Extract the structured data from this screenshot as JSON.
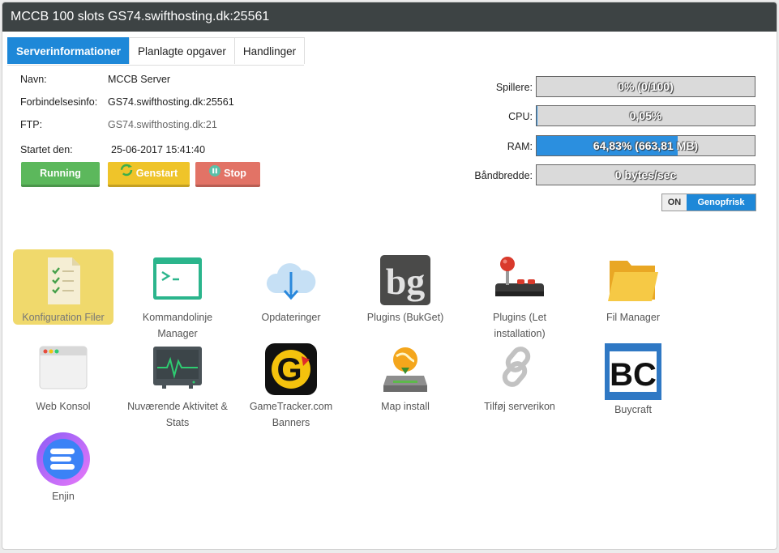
{
  "header": {
    "title": "MCCB 100 slots GS74.swifthosting.dk:25561"
  },
  "tabs": [
    {
      "label": "Serverinformationer",
      "active": true
    },
    {
      "label": "Planlagte opgaver",
      "active": false
    },
    {
      "label": "Handlinger",
      "active": false
    }
  ],
  "info": {
    "name_label": "Navn:",
    "name_value": "MCCB Server",
    "conn_label": "Forbindelsesinfo:",
    "conn_value": "GS74.swifthosting.dk:25561",
    "ftp_label": "FTP:",
    "ftp_value": "GS74.swifthosting.dk:21",
    "started_label": "Startet den:",
    "started_value": "25-06-2017 15:41:40"
  },
  "controls": {
    "running": "Running",
    "restart": "Genstart",
    "stop": "Stop"
  },
  "stats": {
    "players": {
      "label": "Spillere:",
      "text": "0% (0/100)",
      "percent": 0
    },
    "cpu": {
      "label": "CPU:",
      "text": "0,05%",
      "percent": 0.05
    },
    "ram": {
      "label": "RAM:",
      "text": "64,83% (663,81 MB)",
      "percent": 64.83
    },
    "bandwidth": {
      "label": "Båndbredde:",
      "text": "0 bytes/sec",
      "percent": 0
    }
  },
  "refresh": {
    "state": "ON",
    "label": "Genopfrisk"
  },
  "colors": {
    "accent": "#1e88d8",
    "titlebar": "#3d4344",
    "running": "#5cb85c",
    "restart": "#efc42a",
    "stop": "#e27366",
    "highlight": "#f0d96c"
  },
  "tiles": [
    {
      "label": "Konfiguration Filer",
      "icon": "config-file-icon"
    },
    {
      "label": "Kommandolinje Manager",
      "icon": "terminal-icon"
    },
    {
      "label": "Opdateringer",
      "icon": "cloud-download-icon"
    },
    {
      "label": "Plugins (BukGet)",
      "icon": "bukget-icon",
      "logo_text": "bg"
    },
    {
      "label": "Plugins (Let installation)",
      "icon": "joystick-icon"
    },
    {
      "label": "Fil Manager",
      "icon": "folder-icon"
    },
    {
      "label": "Web Konsol",
      "icon": "browser-window-icon"
    },
    {
      "label": "Nuværende Aktivitet & Stats",
      "icon": "activity-monitor-icon"
    },
    {
      "label": "GameTracker.com Banners",
      "icon": "gametracker-icon",
      "logo_text": "G"
    },
    {
      "label": "Map install",
      "icon": "map-install-icon"
    },
    {
      "label": "Tilføj serverikon",
      "icon": "link-icon"
    },
    {
      "label": "Buycraft",
      "icon": "buycraft-icon",
      "logo_text": "BC"
    },
    {
      "label": "Enjin",
      "icon": "enjin-icon"
    }
  ]
}
